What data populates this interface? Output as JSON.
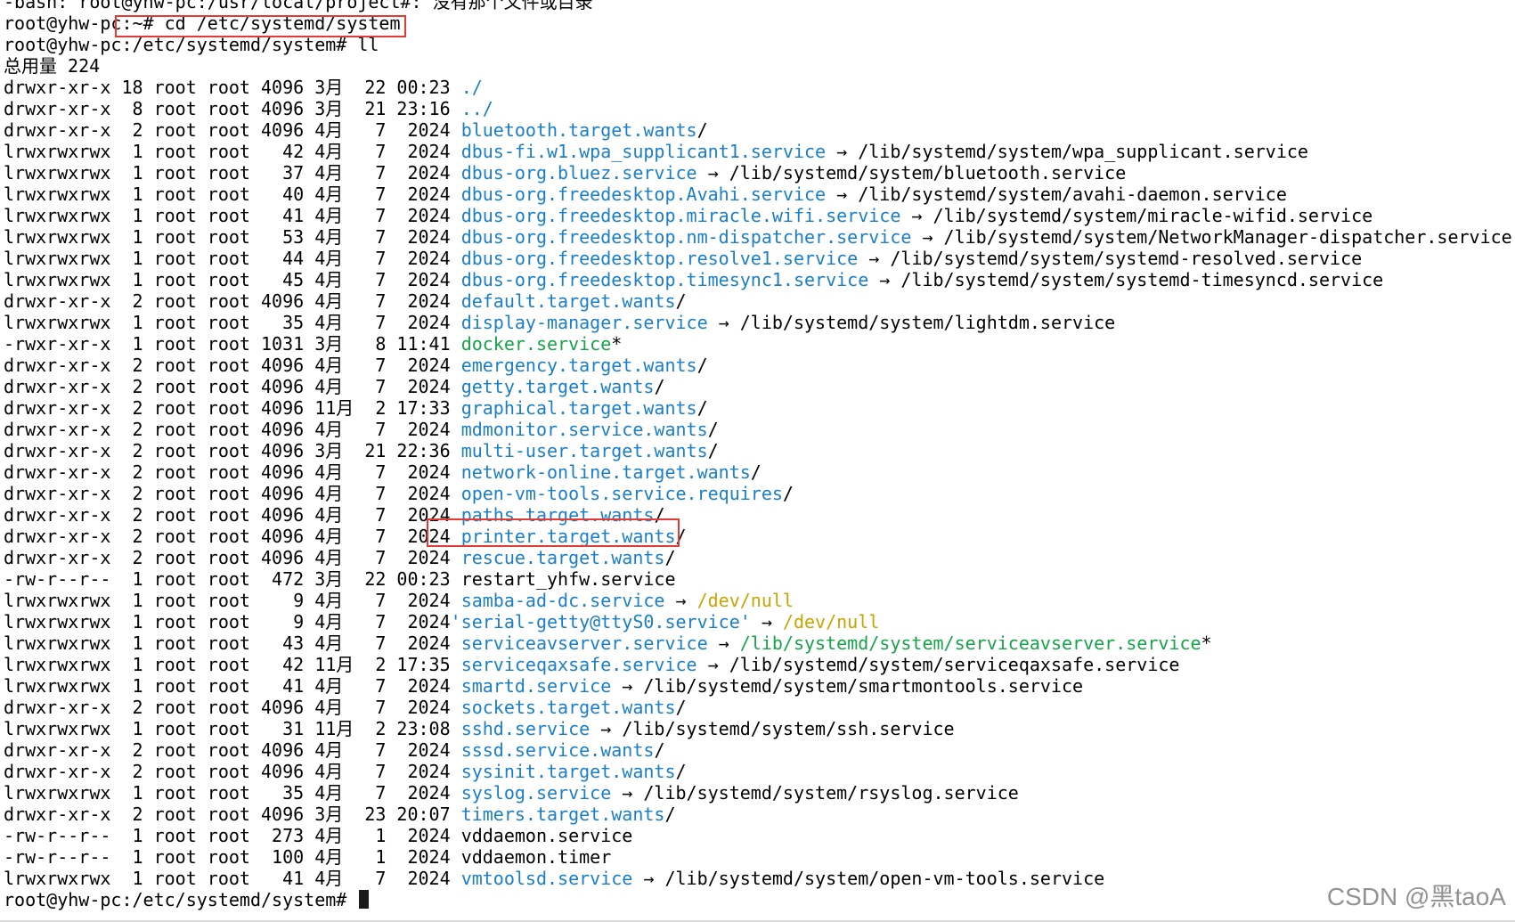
{
  "terminal": {
    "header_lines": [
      "-bash: root@yhw-pc:/usr/local/project#: 没有那个文件或目录",
      "root@yhw-pc:~# cd /etc/systemd/system",
      "root@yhw-pc:/etc/systemd/system# ll",
      "总用量 224"
    ],
    "entries": [
      {
        "meta": "drwxr-xr-x 18 root root 4096 3月  22 00:23 ",
        "name": "./",
        "kind": "dir"
      },
      {
        "meta": "drwxr-xr-x  8 root root 4096 3月  21 23:16 ",
        "name": "../",
        "kind": "dir"
      },
      {
        "meta": "drwxr-xr-x  2 root root 4096 4月   7  2024 ",
        "name": "bluetooth.target.wants",
        "kind": "dir",
        "suffix": "/"
      },
      {
        "meta": "lrwxrwxrwx  1 root root   42 4月   7  2024 ",
        "name": "dbus-fi.w1.wpa_supplicant1.service",
        "kind": "dir",
        "arrow": " → ",
        "target": "/lib/systemd/system/wpa_supplicant.service",
        "target_kind": "plain"
      },
      {
        "meta": "lrwxrwxrwx  1 root root   37 4月   7  2024 ",
        "name": "dbus-org.bluez.service",
        "kind": "dir",
        "arrow": " → ",
        "target": "/lib/systemd/system/bluetooth.service",
        "target_kind": "plain"
      },
      {
        "meta": "lrwxrwxrwx  1 root root   40 4月   7  2024 ",
        "name": "dbus-org.freedesktop.Avahi.service",
        "kind": "dir",
        "arrow": " → ",
        "target": "/lib/systemd/system/avahi-daemon.service",
        "target_kind": "plain"
      },
      {
        "meta": "lrwxrwxrwx  1 root root   41 4月   7  2024 ",
        "name": "dbus-org.freedesktop.miracle.wifi.service",
        "kind": "dir",
        "arrow": " → ",
        "target": "/lib/systemd/system/miracle-wifid.service",
        "target_kind": "plain"
      },
      {
        "meta": "lrwxrwxrwx  1 root root   53 4月   7  2024 ",
        "name": "dbus-org.freedesktop.nm-dispatcher.service",
        "kind": "dir",
        "arrow": " → ",
        "target": "/lib/systemd/system/NetworkManager-dispatcher.service",
        "target_kind": "plain"
      },
      {
        "meta": "lrwxrwxrwx  1 root root   44 4月   7  2024 ",
        "name": "dbus-org.freedesktop.resolve1.service",
        "kind": "dir",
        "arrow": " → ",
        "target": "/lib/systemd/system/systemd-resolved.service",
        "target_kind": "plain"
      },
      {
        "meta": "lrwxrwxrwx  1 root root   45 4月   7  2024 ",
        "name": "dbus-org.freedesktop.timesync1.service",
        "kind": "dir",
        "arrow": " → ",
        "target": "/lib/systemd/system/systemd-timesyncd.service",
        "target_kind": "plain"
      },
      {
        "meta": "drwxr-xr-x  2 root root 4096 4月   7  2024 ",
        "name": "default.target.wants",
        "kind": "dir",
        "suffix": "/"
      },
      {
        "meta": "lrwxrwxrwx  1 root root   35 4月   7  2024 ",
        "name": "display-manager.service",
        "kind": "dir",
        "arrow": " → ",
        "target": "/lib/systemd/system/lightdm.service",
        "target_kind": "plain"
      },
      {
        "meta": "-rwxr-xr-x  1 root root 1031 3月   8 11:41 ",
        "name": "docker.service",
        "kind": "exec",
        "suffix": "*"
      },
      {
        "meta": "drwxr-xr-x  2 root root 4096 4月   7  2024 ",
        "name": "emergency.target.wants",
        "kind": "dir",
        "suffix": "/"
      },
      {
        "meta": "drwxr-xr-x  2 root root 4096 4月   7  2024 ",
        "name": "getty.target.wants",
        "kind": "dir",
        "suffix": "/"
      },
      {
        "meta": "drwxr-xr-x  2 root root 4096 11月  2 17:33 ",
        "name": "graphical.target.wants",
        "kind": "dir",
        "suffix": "/"
      },
      {
        "meta": "drwxr-xr-x  2 root root 4096 4月   7  2024 ",
        "name": "mdmonitor.service.wants",
        "kind": "dir",
        "suffix": "/"
      },
      {
        "meta": "drwxr-xr-x  2 root root 4096 3月  21 22:36 ",
        "name": "multi-user.target.wants",
        "kind": "dir",
        "suffix": "/"
      },
      {
        "meta": "drwxr-xr-x  2 root root 4096 4月   7  2024 ",
        "name": "network-online.target.wants",
        "kind": "dir",
        "suffix": "/"
      },
      {
        "meta": "drwxr-xr-x  2 root root 4096 4月   7  2024 ",
        "name": "open-vm-tools.service.requires",
        "kind": "dir",
        "suffix": "/"
      },
      {
        "meta": "drwxr-xr-x  2 root root 4096 4月   7  2024 ",
        "name": "paths.target.wants",
        "kind": "dir",
        "suffix": "/"
      },
      {
        "meta": "drwxr-xr-x  2 root root 4096 4月   7  2024 ",
        "name": "printer.target.wants",
        "kind": "dir",
        "suffix": "/"
      },
      {
        "meta": "drwxr-xr-x  2 root root 4096 4月   7  2024 ",
        "name": "rescue.target.wants",
        "kind": "dir",
        "suffix": "/"
      },
      {
        "meta": "-rw-r--r--  1 root root  472 3月  22 00:23 ",
        "name": "restart_yhfw.service",
        "kind": "plain"
      },
      {
        "meta": "lrwxrwxrwx  1 root root    9 4月   7  2024 ",
        "name": "samba-ad-dc.service",
        "kind": "dir",
        "arrow": " → ",
        "target": "/dev/null",
        "target_kind": "dev"
      },
      {
        "meta": "lrwxrwxrwx  1 root root    9 4月   7  2024",
        "name": "'serial-getty@ttyS0.service'",
        "kind": "dir",
        "arrow": " → ",
        "target": "/dev/null",
        "target_kind": "dev"
      },
      {
        "meta": "lrwxrwxrwx  1 root root   43 4月   7  2024 ",
        "name": "serviceavserver.service",
        "kind": "dir",
        "arrow": " → ",
        "target": "/lib/systemd/system/serviceavserver.service",
        "target_kind": "exec",
        "target_suffix": "*"
      },
      {
        "meta": "lrwxrwxrwx  1 root root   42 11月  2 17:35 ",
        "name": "serviceqaxsafe.service",
        "kind": "dir",
        "arrow": " → ",
        "target": "/lib/systemd/system/serviceqaxsafe.service",
        "target_kind": "plain"
      },
      {
        "meta": "lrwxrwxrwx  1 root root   41 4月   7  2024 ",
        "name": "smartd.service",
        "kind": "dir",
        "arrow": " → ",
        "target": "/lib/systemd/system/smartmontools.service",
        "target_kind": "plain"
      },
      {
        "meta": "drwxr-xr-x  2 root root 4096 4月   7  2024 ",
        "name": "sockets.target.wants",
        "kind": "dir",
        "suffix": "/"
      },
      {
        "meta": "lrwxrwxrwx  1 root root   31 11月  2 23:08 ",
        "name": "sshd.service",
        "kind": "dir",
        "arrow": " → ",
        "target": "/lib/systemd/system/ssh.service",
        "target_kind": "plain"
      },
      {
        "meta": "drwxr-xr-x  2 root root 4096 4月   7  2024 ",
        "name": "sssd.service.wants",
        "kind": "dir",
        "suffix": "/"
      },
      {
        "meta": "drwxr-xr-x  2 root root 4096 4月   7  2024 ",
        "name": "sysinit.target.wants",
        "kind": "dir",
        "suffix": "/"
      },
      {
        "meta": "lrwxrwxrwx  1 root root   35 4月   7  2024 ",
        "name": "syslog.service",
        "kind": "dir",
        "arrow": " → ",
        "target": "/lib/systemd/system/rsyslog.service",
        "target_kind": "plain"
      },
      {
        "meta": "drwxr-xr-x  2 root root 4096 3月  23 20:07 ",
        "name": "timers.target.wants",
        "kind": "dir",
        "suffix": "/"
      },
      {
        "meta": "-rw-r--r--  1 root root  273 4月   1  2024 ",
        "name": "vddaemon.service",
        "kind": "plain"
      },
      {
        "meta": "-rw-r--r--  1 root root  100 4月   1  2024 ",
        "name": "vddaemon.timer",
        "kind": "plain"
      },
      {
        "meta": "lrwxrwxrwx  1 root root   41 4月   7  2024 ",
        "name": "vmtoolsd.service",
        "kind": "dir",
        "arrow": " → ",
        "target": "/lib/systemd/system/open-vm-tools.service",
        "target_kind": "plain"
      }
    ],
    "prompt": "root@yhw-pc:/etc/systemd/system# "
  },
  "watermark": "CSDN @黑taoA",
  "colors": {
    "background": "#ffffff",
    "directory": "#1a7fc6",
    "executable": "#16a34a",
    "device": "#c9a300",
    "highlight": "#e53935"
  },
  "icons": {
    "cursor": "block-cursor"
  }
}
